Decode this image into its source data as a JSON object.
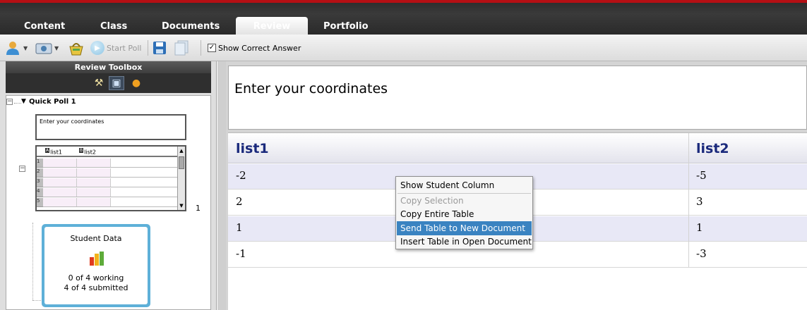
{
  "tabs": [
    "Content",
    "Class",
    "Documents",
    "Review",
    "Portfolio"
  ],
  "active_tab": "Review",
  "toolbar": {
    "start_poll": "Start Poll",
    "show_correct_answer": "Show Correct Answer",
    "show_correct_checked": "✓"
  },
  "toolbox": {
    "title": "Review Toolbox",
    "tree": {
      "poll_label": "Quick Poll 1",
      "question_thumb": "Enter your coordinates",
      "thumb_columns": [
        "list1",
        "list2"
      ],
      "thumb_column_letters": [
        "A",
        "B"
      ],
      "thumb_rows": [
        "1",
        "2",
        "3",
        "4",
        "5"
      ],
      "page_number": "1"
    },
    "student_data": {
      "title": "Student Data",
      "working": "0 of 4 working",
      "submitted": "4 of 4 submitted"
    }
  },
  "main": {
    "question": "Enter your coordinates",
    "table": {
      "headers": [
        "list1",
        "list2"
      ],
      "rows": [
        [
          "-2",
          "-5"
        ],
        [
          "2",
          "3"
        ],
        [
          "1",
          "1"
        ],
        [
          "-1",
          "-3"
        ]
      ]
    }
  },
  "context_menu": {
    "items": [
      "Show Student Column",
      "Copy Selection",
      "Copy Entire Table",
      "Send Table to New Document",
      "Insert Table in Open Document"
    ],
    "highlighted": "Send Table to New Document",
    "disabled": [
      "Copy Selection"
    ]
  },
  "colors": {
    "accent_red": "#b50f14",
    "menu_highlight": "#3a83c1",
    "header_text": "#1b2a7c",
    "card_border": "#5eb0d8"
  }
}
